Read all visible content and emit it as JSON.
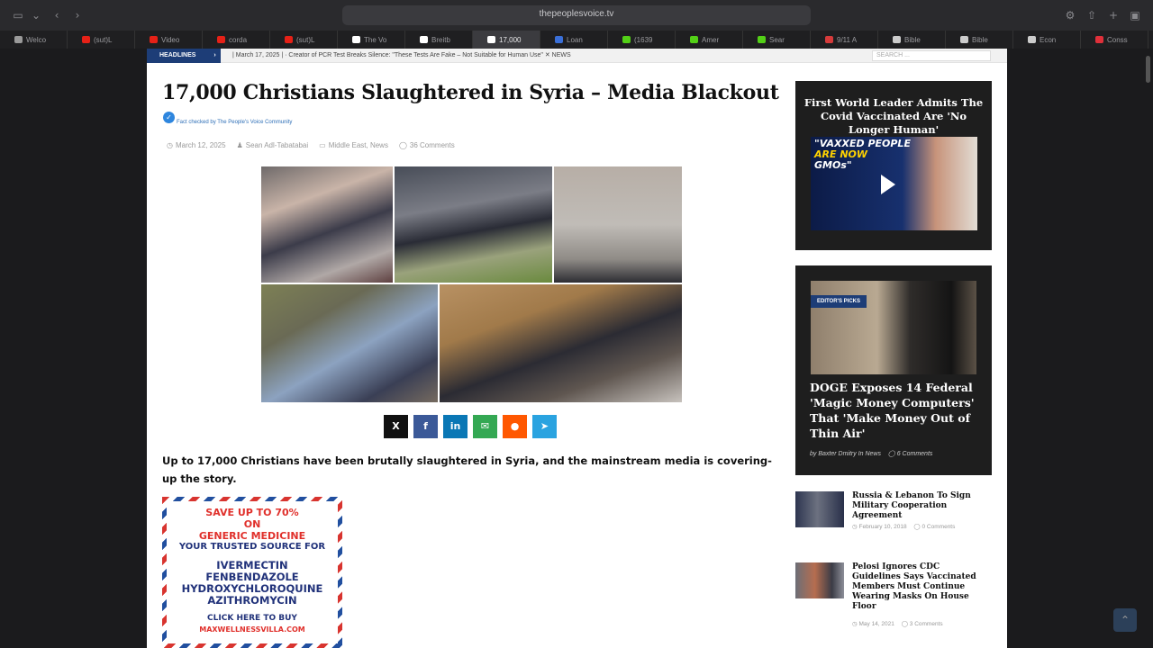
{
  "browser": {
    "url": "thepeoplesvoice.tv",
    "tabs": [
      {
        "label": "Welco",
        "color": "#9a9a9a",
        "active": false
      },
      {
        "label": "(sut)L",
        "color": "#e62117",
        "active": false
      },
      {
        "label": "Video",
        "color": "#e62117",
        "active": false
      },
      {
        "label": "corda",
        "color": "#e62117",
        "active": false
      },
      {
        "label": "(sut)L",
        "color": "#e62117",
        "active": false
      },
      {
        "label": "The Vo",
        "color": "#ffffff",
        "active": false
      },
      {
        "label": "Breitb",
        "color": "#ffffff",
        "active": false
      },
      {
        "label": "17,000",
        "color": "#ffffff",
        "active": true
      },
      {
        "label": "Loan",
        "color": "#3a6fd8",
        "active": false
      },
      {
        "label": "(1639",
        "color": "#53d017",
        "active": false
      },
      {
        "label": "Amer",
        "color": "#53d017",
        "active": false
      },
      {
        "label": "Sear",
        "color": "#53d017",
        "active": false
      },
      {
        "label": "9/11 A",
        "color": "#d63b3b",
        "active": false
      },
      {
        "label": "Bible",
        "color": "#cccccc",
        "active": false
      },
      {
        "label": "Bible",
        "color": "#cccccc",
        "active": false
      },
      {
        "label": "Econ",
        "color": "#cccccc",
        "active": false
      },
      {
        "label": "Conss",
        "color": "#e0303a",
        "active": false
      }
    ]
  },
  "ticker": {
    "label": "HEADLINES",
    "arrow": "›",
    "text": "| March 17, 2025 | · Creator of PCR Test Breaks Silence: \"These Tests Are Fake – Not Suitable for Human Use\"  ✕  NEWS",
    "search_placeholder": "SEARCH ..."
  },
  "article": {
    "title": "17,000 Christians Slaughtered in Syria – Media Blackout",
    "fact_checked": "Fact checked by The People's Voice Community",
    "date": "March 12, 2025",
    "author": "Sean Adl-Tabatabai",
    "category": "Middle East, News",
    "comments": "36 Comments",
    "lead": "Up to 17,000 Christians have been brutally slaughtered in Syria, and the mainstream media is covering-up the story."
  },
  "share": [
    {
      "name": "x",
      "glyph": "X",
      "color": "#111111"
    },
    {
      "name": "facebook",
      "glyph": "f",
      "color": "#3b5998"
    },
    {
      "name": "linkedin",
      "glyph": "in",
      "color": "#0a77b5"
    },
    {
      "name": "email",
      "glyph": "✉",
      "color": "#34a853"
    },
    {
      "name": "reddit",
      "glyph": "●",
      "color": "#ff5700"
    },
    {
      "name": "telegram",
      "glyph": "➤",
      "color": "#2aa3e0"
    }
  ],
  "ad": {
    "line1": "SAVE UP TO 70%",
    "line2": "ON",
    "line3": "GENERIC MEDICINE",
    "line4": "YOUR TRUSTED SOURCE FOR",
    "drugs": [
      "IVERMECTIN",
      "FENBENDAZOLE",
      "HYDROXYCHLOROQUINE",
      "AZITHROMYCIN"
    ],
    "cta": "CLICK HERE TO BUY",
    "site": "MAXWELLNESSVILLA.COM"
  },
  "sidebar": {
    "card1": {
      "title": "First World Leader Admits The Covid Vaccinated Are 'No Longer Human'",
      "thumb_line1": "\"VAXXED PEOPLE",
      "thumb_line2": "ARE NOW",
      "thumb_line3": "GMOs\""
    },
    "card2": {
      "badge": "EDITOR'S PICKS",
      "title": "DOGE Exposes 14 Federal 'Magic Money Computers' That 'Make Money Out of Thin Air'",
      "byline": "by Baxter Dmitry In News",
      "comments": "6 Comments"
    },
    "mini": [
      {
        "title": "Russia & Lebanon To Sign Military Cooperation Agreement",
        "date": "February 10, 2018",
        "comments": "0 Comments"
      },
      {
        "title": "Pelosi Ignores CDC Guidelines Says Vaccinated Members Must Continue Wearing Masks On House Floor",
        "date": "May 14, 2021",
        "comments": "3 Comments"
      }
    ]
  }
}
